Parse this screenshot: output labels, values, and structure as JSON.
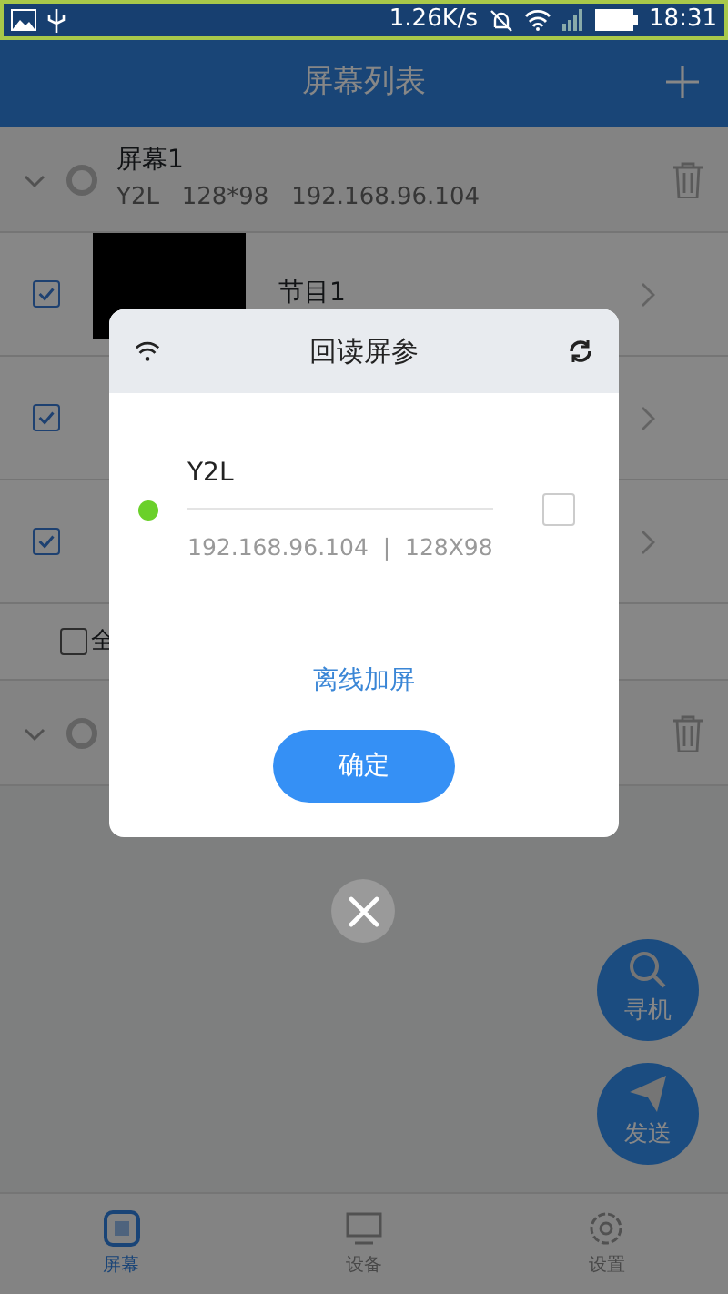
{
  "status_bar": {
    "speed": "1.26K/s",
    "time": "18:31"
  },
  "header": {
    "title": "屏幕列表"
  },
  "screens": [
    {
      "name": "屏幕1",
      "info": "Y2L   128*98   192.168.96.104",
      "expanded": true,
      "programs": [
        {
          "name": "节目1",
          "thumbnail": true,
          "checked": true
        },
        {
          "checked": true
        },
        {
          "checked": true
        }
      ],
      "select_all": {
        "label": "全",
        "checked": false
      }
    },
    {
      "expanded": true
    }
  ],
  "fabs": [
    {
      "label": "寻机",
      "kind": "search"
    },
    {
      "label": "发送",
      "kind": "send"
    }
  ],
  "tabs": [
    {
      "label": "屏幕",
      "kind": "screen",
      "selected": true
    },
    {
      "label": "设备",
      "kind": "device",
      "selected": false
    },
    {
      "label": "设置",
      "kind": "settings",
      "selected": false
    }
  ],
  "dialog": {
    "title": "回读屏参",
    "devices": [
      {
        "name": "Y2L",
        "detail": "192.168.96.104  |  128X98",
        "online": true,
        "checked": false
      }
    ],
    "link": "离线加屏",
    "confirm": "确定"
  }
}
